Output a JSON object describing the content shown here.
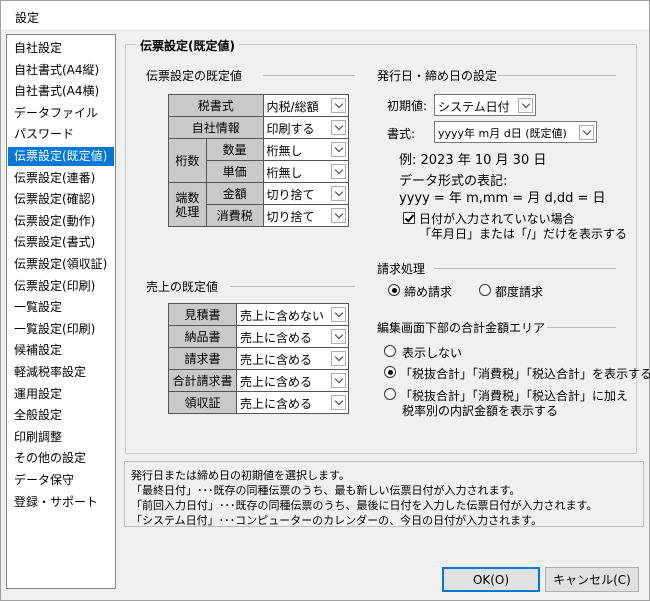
{
  "window": {
    "title": "設定"
  },
  "sidebar": {
    "items": [
      "自社設定",
      "自社書式(A4縦)",
      "自社書式(A4横)",
      "データファイル",
      "パスワード",
      "伝票設定(既定値)",
      "伝票設定(連番)",
      "伝票設定(確認)",
      "伝票設定(動作)",
      "伝票設定(書式)",
      "伝票設定(領収証)",
      "伝票設定(印刷)",
      "一覧設定",
      "一覧設定(印刷)",
      "候補設定",
      "軽減税率設定",
      "運用設定",
      "全般設定",
      "印刷調整",
      "その他の設定",
      "データ保守",
      "登録・サポート"
    ],
    "selected_index": 5
  },
  "panel": {
    "title": "伝票設定(既定値)",
    "defaults": {
      "legend": "伝票設定の既定値",
      "tax_format_label": "税書式",
      "tax_format_value": "内税/総額",
      "company_info_label": "自社情報",
      "company_info_value": "印刷する",
      "digits_label": "桁数",
      "quantity_label": "数量",
      "quantity_value": "桁無し",
      "unit_price_label": "単価",
      "unit_price_value": "桁無し",
      "fraction_label_1": "端数",
      "fraction_label_2": "処理",
      "amount_label": "金額",
      "amount_value": "切り捨て",
      "consumption_tax_label": "消費税",
      "consumption_tax_value": "切り捨て"
    },
    "dates": {
      "legend": "発行日・締め日の設定",
      "initial_label": "初期値:",
      "initial_value": "システム日付",
      "format_label": "書式:",
      "format_value": "yyyy年 m月 d日 (既定値)",
      "example": "例: 2023 年 10 月 30 日",
      "notation_title": "データ形式の表記:",
      "notation": "yyyy = 年 m,mm = 月 d,dd = 日",
      "checkbox_line1": "日付が入力されていない場合",
      "checkbox_line2": "「年月日」または「/」だけを表示する",
      "checkbox_checked": true
    },
    "sales": {
      "legend": "売上の既定値",
      "rows": [
        {
          "label": "見積書",
          "value": "売上に含めない"
        },
        {
          "label": "納品書",
          "value": "売上に含める"
        },
        {
          "label": "請求書",
          "value": "売上に含める"
        },
        {
          "label": "合計請求書",
          "value": "売上に含める"
        },
        {
          "label": "領収証",
          "value": "売上に含める"
        }
      ]
    },
    "billing": {
      "legend": "請求処理",
      "option1": "締め請求",
      "option2": "都度請求",
      "selected": 1
    },
    "totals": {
      "legend": "編集画面下部の合計金額エリア",
      "option1": "表示しない",
      "option2": "「税抜合計」「消費税」「税込合計」を表示する",
      "option3_line1": "「税抜合計」「消費税」「税込合計」に加え",
      "option3_line2": "税率別の内訳金額を表示する",
      "selected": 2
    }
  },
  "description": {
    "lines": [
      "発行日または締め日の初期値を選択します。",
      "「最終日付」･･･既存の同種伝票のうち、最も新しい伝票日付が入力されます。",
      "「前回入力日付」･･･既存の同種伝票のうち、最後に日付を入力した伝票日付が入力されます。",
      "「システム日付」･･･コンピューターのカレンダーの、今日の日付が入力されます。"
    ]
  },
  "buttons": {
    "ok": "OK(O)",
    "cancel": "キャンセル(C)"
  },
  "colors": {
    "selection": "#0078d7",
    "label_cell": "#c9c9c9"
  }
}
